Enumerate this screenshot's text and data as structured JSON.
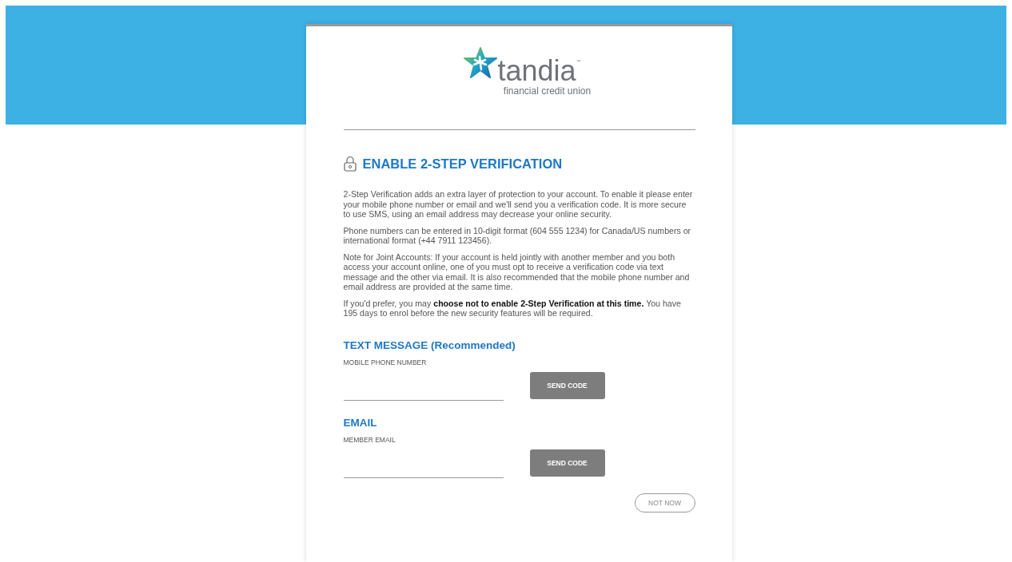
{
  "logo": {
    "name": "tandia",
    "mark": "™",
    "tagline": "financial credit union"
  },
  "title": "ENABLE 2-STEP VERIFICATION",
  "paragraphs": [
    "2-Step Verification adds an extra layer of protection to your account. To enable it please enter your mobile phone number or email and we'll send you a verification code. It is more secure to use SMS, using an email address may decrease your online security.",
    "Phone numbers can be entered in 10-digit format (604 555 1234) for Canada/US numbers or international format (+44 7911 123456).",
    "Note for Joint Accounts: If your account is held jointly with another member and you both access your account online, one of you must opt to receive a verification code via text message and the other via email. It is also recommended that the mobile phone number and email address are provided at the same time.",
    "If you'd prefer, you may **choose not to enable 2-Step Verification at this time.** You have 195 days to enrol before the new security features will be required."
  ],
  "methods": [
    {
      "heading": "TEXT MESSAGE (Recommended)",
      "field_label": "MOBILE PHONE NUMBER",
      "button": "SEND CODE"
    },
    {
      "heading": "EMAIL",
      "field_label": "MEMBER EMAIL",
      "button": "SEND CODE"
    }
  ],
  "not_now_button": "NOT NOW"
}
